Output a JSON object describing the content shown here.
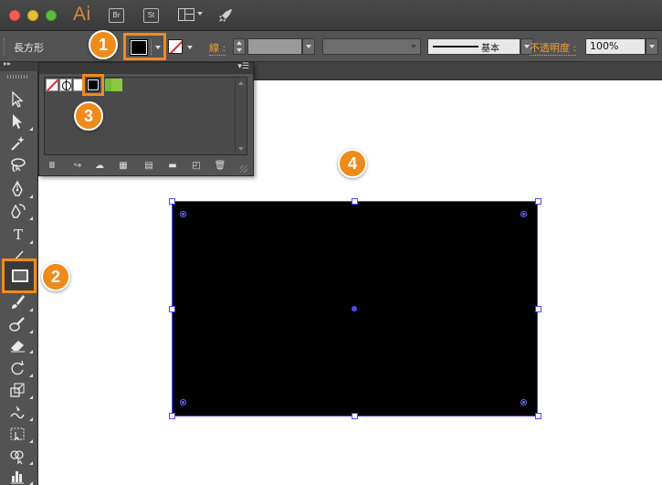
{
  "titlebar": {
    "app_logo": "Ai",
    "bridge_badge": "Br",
    "stock_badge": "St",
    "icons": [
      "workspace-layout-icon",
      "rocket-icon"
    ]
  },
  "controlbar": {
    "object_type": "長方形",
    "fill_color": "#000000",
    "stroke_label": "線",
    "stroke_label_suffix": ":",
    "brush_label": "基本",
    "opacity_label": "不透明度",
    "opacity_label_suffix": ":",
    "opacity_value": "100%"
  },
  "tools": {
    "text_tool": "T",
    "icons": [
      "selection-tool-icon",
      "direct-selection-tool-icon",
      "magic-wand-icon",
      "lasso-icon",
      "pen-tool-icon",
      "curvature-tool-icon",
      "type-tool-icon",
      "line-tool-icon",
      "rectangle-tool-icon",
      "paintbrush-icon",
      "blob-brush-icon",
      "eraser-icon",
      "rotate-tool-icon",
      "scale-tool-icon",
      "warp-tool-icon",
      "free-transform-icon",
      "shape-builder-icon",
      "graph-tool-icon"
    ]
  },
  "swatches_panel": {
    "swatches": [
      "none",
      "registration",
      "white",
      "black",
      "green",
      "green-light"
    ],
    "footer_icons": [
      "swatch-library-icon",
      "place-swatches-icon",
      "cc-libraries-icon",
      "show-kinds-icon",
      "swatch-options-icon",
      "new-color-group-icon",
      "new-swatch-icon",
      "delete-swatch-icon"
    ]
  },
  "callouts": {
    "c1": "1",
    "c2": "2",
    "c3": "3",
    "c4": "4"
  },
  "colors": {
    "accent": "#f08c17",
    "selection": "#4a4aff",
    "rectangle_fill": "#000000"
  }
}
